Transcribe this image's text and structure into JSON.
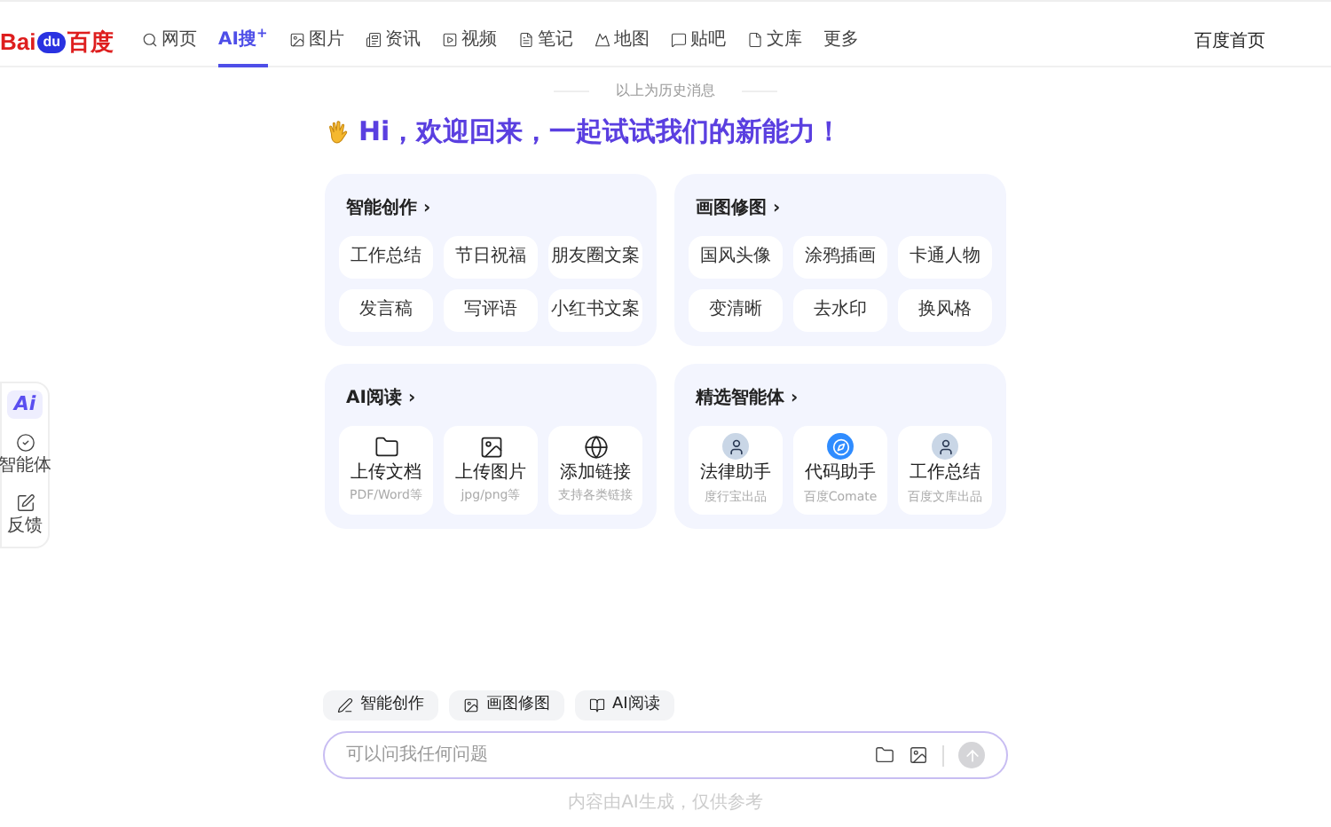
{
  "logo": {
    "left": "Bai",
    "paw": "du",
    "right": "百度"
  },
  "nav": [
    {
      "label": "网页",
      "selected": false
    },
    {
      "label": "AI搜$^{+}$",
      "selected": true
    },
    {
      "label": "图片",
      "selected": false
    },
    {
      "label": "资讯",
      "selected": false
    },
    {
      "label": "视频",
      "selected": false
    },
    {
      "label": "笔记",
      "selected": false
    },
    {
      "label": "地图",
      "selected": false
    },
    {
      "label": "贴吧",
      "selected": false
    },
    {
      "label": "文库",
      "selected": false
    },
    {
      "label": "更多",
      "selected": false
    }
  ],
  "home_link": "百度首页",
  "sidebar": {
    "ai_badge": "Ai",
    "items": [
      "智能体",
      "反馈"
    ]
  },
  "history_note": "以上为历史消息",
  "greeting": "Hi，欢迎回来，一起试试我们的新能力！",
  "cards": [
    {
      "kind": "chips",
      "title": "智能创作 ›",
      "items": [
        {
          "label": "工作总结"
        },
        {
          "label": "节日祝福"
        },
        {
          "label": "朋友圈文案"
        },
        {
          "label": "发言稿"
        },
        {
          "label": "写评语"
        },
        {
          "label": "小红书文案"
        }
      ]
    },
    {
      "kind": "chips",
      "title": "画图修图 ›",
      "items": [
        {
          "label": "国风头像"
        },
        {
          "label": "涂鸦插画"
        },
        {
          "label": "卡通人物"
        },
        {
          "label": "变清晰"
        },
        {
          "label": "去水印"
        },
        {
          "label": "换风格"
        }
      ]
    },
    {
      "kind": "tools",
      "title": "AI阅读 ›",
      "items": [
        {
          "label": "上传文档",
          "sub": "PDF/Word等"
        },
        {
          "label": "上传图片",
          "sub": "jpg/png等"
        },
        {
          "label": "添加链接",
          "sub": "支持各类链接"
        }
      ]
    },
    {
      "kind": "agents",
      "title": "精选智能体 ›",
      "items": [
        {
          "label": "法律助手",
          "sub": "度行宝出品"
        },
        {
          "label": "代码助手",
          "sub": "百度Comate"
        },
        {
          "label": "工作总结",
          "sub": "百度文库出品"
        }
      ]
    }
  ],
  "quick_actions": [
    "智能创作",
    "画图修图",
    "AI阅读"
  ],
  "input": {
    "placeholder": "可以问我任何问题"
  },
  "footer_note": "内容由AI生成，仅供参考"
}
